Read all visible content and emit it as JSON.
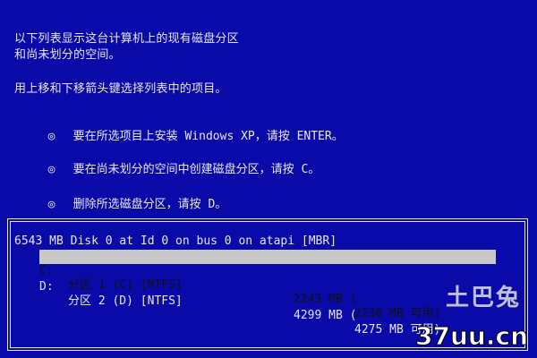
{
  "screen": {
    "colors": {
      "background": "#0a0aa8",
      "text": "#e6e6e6",
      "selection": "#c8c8c8"
    }
  },
  "intro": {
    "line1": "以下列表显示这台计算机上的现有磁盘分区",
    "line2": "和尚未划分的空间。",
    "line3": "用上移和下移箭头键选择列表中的项目。"
  },
  "options": [
    {
      "bullet": "◎",
      "text": "要在所选项目上安装 Windows XP，请按 ENTER。"
    },
    {
      "bullet": "◎",
      "text": "要在尚未划分的空间中创建磁盘分区，请按 C。"
    },
    {
      "bullet": "◎",
      "text": "删除所选磁盘分区，请按 D。"
    }
  ],
  "disk": {
    "header": "6543 MB Disk 0 at Id 0 on bus 0 on atapi [MBR]",
    "partitions": [
      {
        "drive": "C:",
        "name": "分区 1 (C) [NTFS]",
        "size": "2243 MB (",
        "free": "2230 MB 可用)",
        "selected": true
      },
      {
        "drive": "D:",
        "name": "分区 2 (D) [NTFS]",
        "size": "4299 MB (",
        "free": "4275 MB 可用)",
        "selected": false
      }
    ]
  },
  "watermark": {
    "logo": "土巴兔",
    "url": "37uu.cn"
  }
}
